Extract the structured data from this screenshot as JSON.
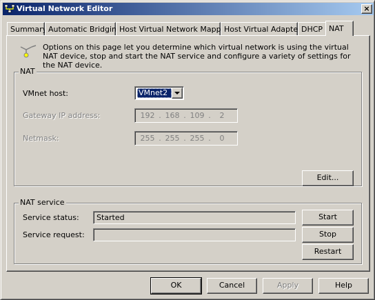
{
  "window": {
    "title": "Virtual Network Editor",
    "close_label": "×",
    "app_icon": "network-icon",
    "colors": {
      "titlebar_start": "#0a246a",
      "titlebar_end": "#a6caf0",
      "face": "#d4d0c8"
    }
  },
  "tabs": [
    {
      "label": "Summary",
      "active": false
    },
    {
      "label": "Automatic Bridging",
      "active": false
    },
    {
      "label": "Host Virtual Network Mapping",
      "active": false
    },
    {
      "label": "Host Virtual Adapters",
      "active": false
    },
    {
      "label": "DHCP",
      "active": false
    },
    {
      "label": "NAT",
      "active": true
    }
  ],
  "info": {
    "icon": "nat-network-icon",
    "text": "Options on this page let you determine which virtual network is using the virtual NAT device, stop and start the NAT service and configure a variety of settings for the NAT device."
  },
  "nat": {
    "group_label": "NAT",
    "vmnet_host_label": "VMnet host:",
    "vmnet_host_value": "VMnet2",
    "gateway_label": "Gateway IP address:",
    "gateway_octets": [
      "192",
      "168",
      "109",
      "2"
    ],
    "netmask_label": "Netmask:",
    "netmask_octets": [
      "255",
      "255",
      "255",
      "0"
    ],
    "edit_button": "Edit..."
  },
  "nat_service": {
    "group_label": "NAT service",
    "status_label": "Service status:",
    "status_value": "Started",
    "request_label": "Service request:",
    "request_value": "",
    "start_button": "Start",
    "stop_button": "Stop",
    "restart_button": "Restart"
  },
  "footer": {
    "ok": "OK",
    "cancel": "Cancel",
    "apply": "Apply",
    "help": "Help"
  }
}
